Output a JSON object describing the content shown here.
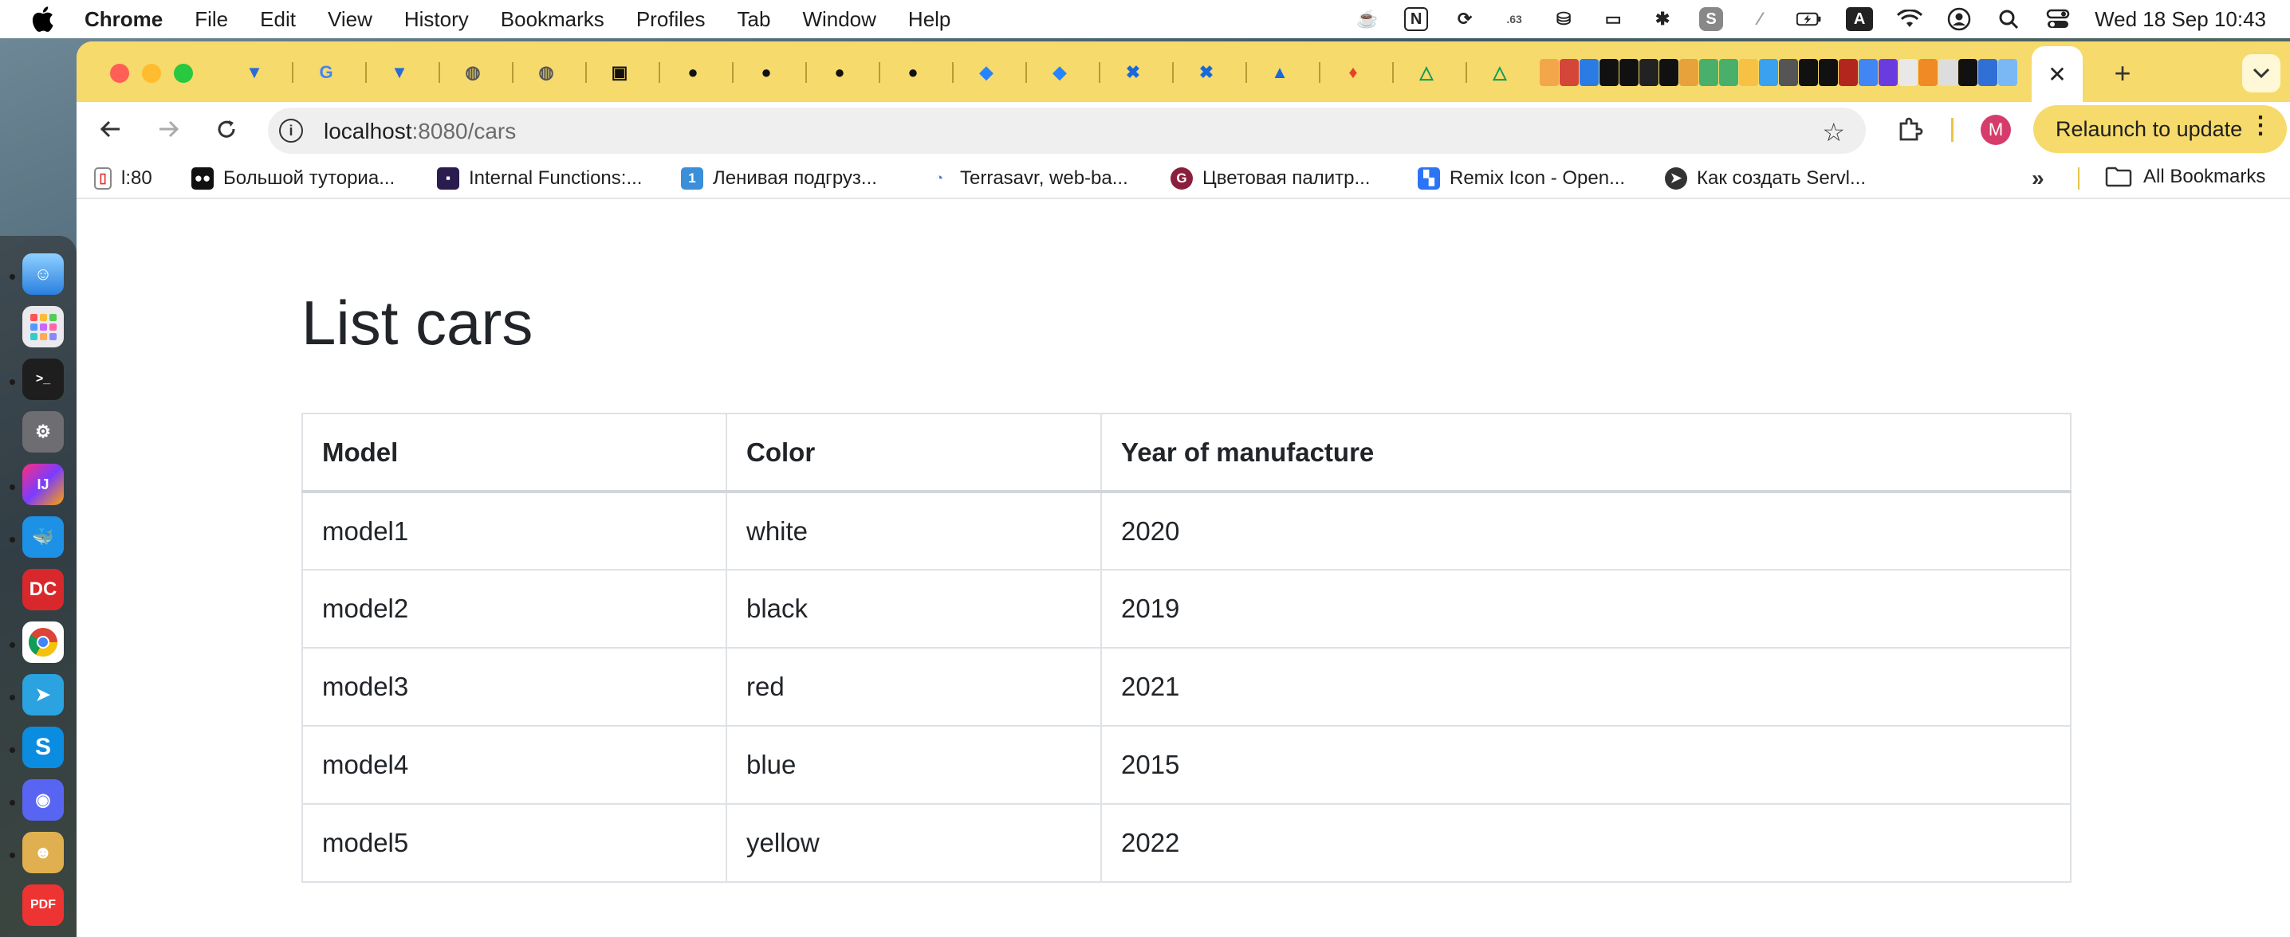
{
  "menubar": {
    "app_name": "Chrome",
    "menus": [
      "File",
      "Edit",
      "View",
      "History",
      "Bookmarks",
      "Profiles",
      "Tab",
      "Window",
      "Help"
    ],
    "status_badge": ".63",
    "input_source": "A",
    "clock": "Wed 18 Sep  10:43"
  },
  "tabs": {
    "favicons": [
      "funnel-icon",
      "google-icon",
      "funnel-icon",
      "globe-icon",
      "globe-icon",
      "dark-app-icon",
      "github-icon",
      "github-icon",
      "github-icon",
      "github-icon",
      "jira-icon",
      "jira-icon",
      "confluence-icon",
      "confluence-icon",
      "atlassian-icon",
      "gitlab-icon",
      "google-drive-icon",
      "google-drive-icon"
    ],
    "active_tab_close": "✕",
    "new_tab": "+"
  },
  "toolbar": {
    "url_host": "localhost",
    "url_rest": ":8080/cars",
    "profile_initial": "M",
    "relaunch_label": "Relaunch to update"
  },
  "bookmarks": {
    "items": [
      {
        "label": "l:80"
      },
      {
        "label": "Большой туториа..."
      },
      {
        "label": "Internal Functions:..."
      },
      {
        "label": "Ленивая подгруз..."
      },
      {
        "label": "Terrasavr, web-ba..."
      },
      {
        "label": "Цветовая палитр..."
      },
      {
        "label": "Remix Icon - Open..."
      },
      {
        "label": "Как создать Servl..."
      }
    ],
    "more": "»",
    "all_bookmarks": "All Bookmarks"
  },
  "page": {
    "title": "List cars",
    "columns": [
      "Model",
      "Color",
      "Year of manufacture"
    ],
    "rows": [
      {
        "model": "model1",
        "color": "white",
        "year": "2020"
      },
      {
        "model": "model2",
        "color": "black",
        "year": "2019"
      },
      {
        "model": "model3",
        "color": "red",
        "year": "2021"
      },
      {
        "model": "model4",
        "color": "blue",
        "year": "2015"
      },
      {
        "model": "model5",
        "color": "yellow",
        "year": "2022"
      }
    ]
  },
  "colors": {
    "tabstrip": "#f6da6b",
    "profile": "#d63c6b",
    "text": "#212529",
    "table_border": "#dee2e6"
  }
}
